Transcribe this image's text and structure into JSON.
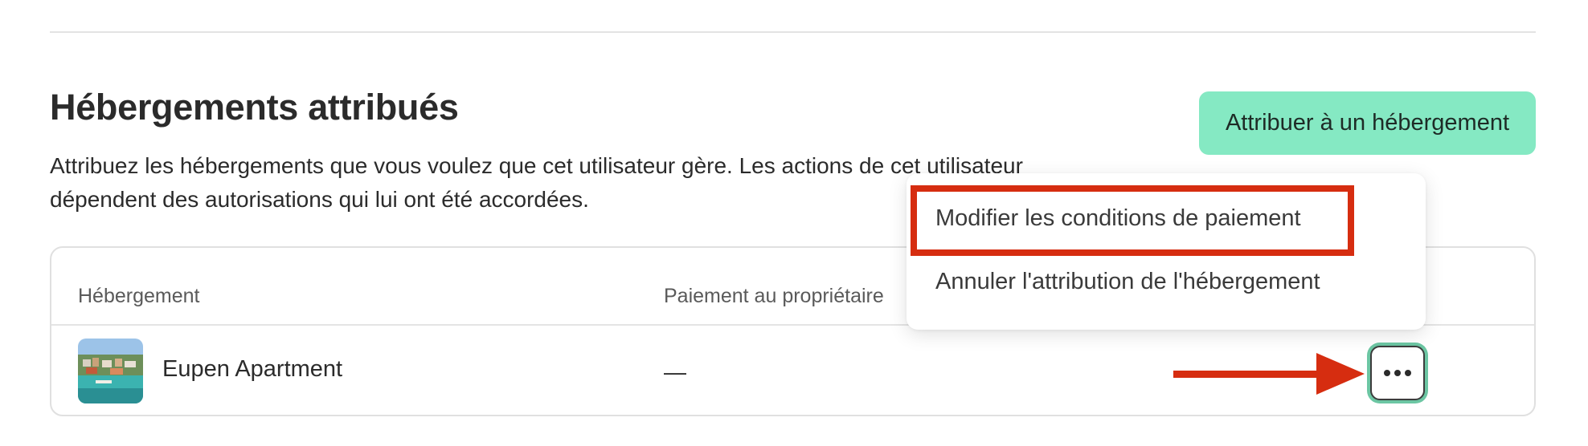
{
  "section": {
    "title": "Hébergements attribués",
    "description": "Attribuez les hébergements que vous voulez que cet utilisateur gère. Les actions de cet utilisateur dépendent des autorisations qui lui ont été accordées.",
    "assign_button_label": "Attribuer à un hébergement"
  },
  "table": {
    "columns": [
      "Hébergement",
      "Paiement au propriétaire"
    ],
    "rows": [
      {
        "property_name": "Eupen Apartment",
        "payment": "—",
        "other": "—"
      }
    ]
  },
  "menu": {
    "items": [
      "Modifier les conditions de paiement",
      "Annuler l'attribution de l'hébergement"
    ]
  },
  "colors": {
    "accent": "#85e9c3",
    "annotation": "#d62d10",
    "focus_ring": "#6cc6a3"
  }
}
